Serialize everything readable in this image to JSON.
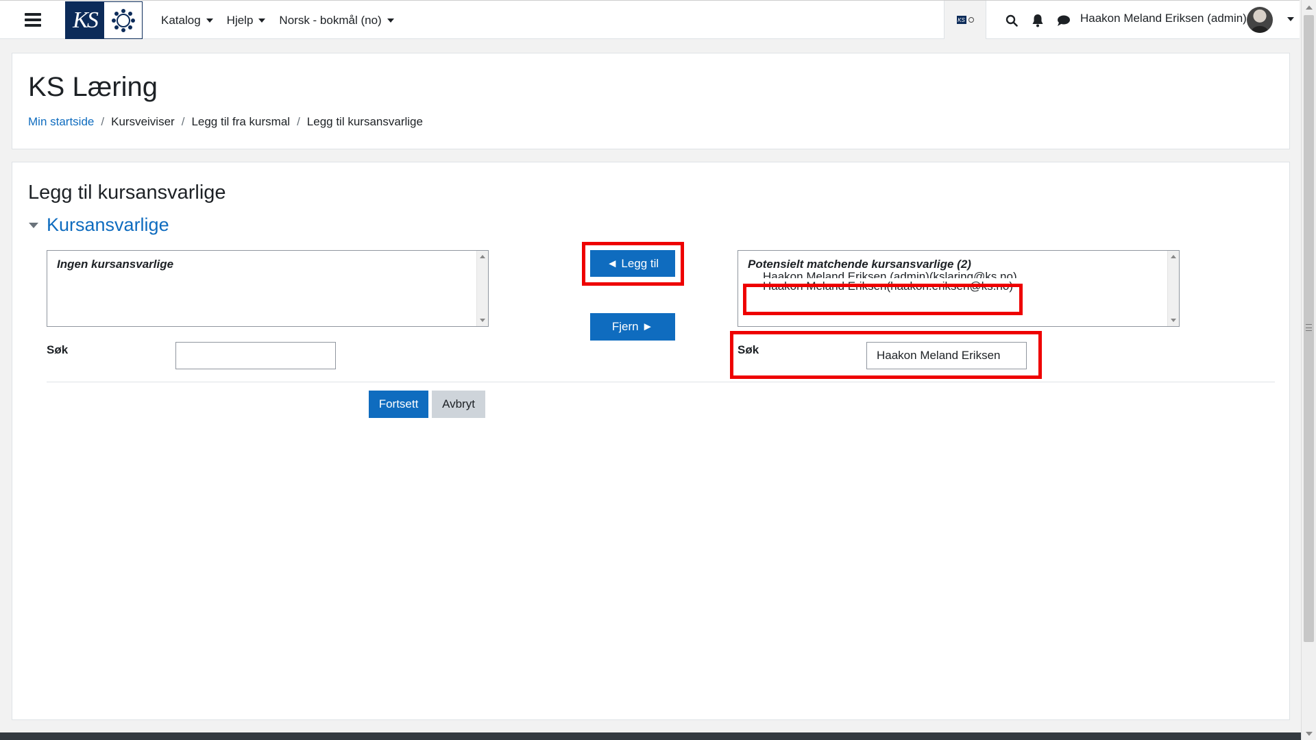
{
  "navbar": {
    "logo_text": "KS",
    "menu": [
      {
        "label": "Katalog"
      },
      {
        "label": "Hjelp"
      },
      {
        "label": "Norsk - bokmål (no)"
      }
    ],
    "mini_logo_text": "KS",
    "user_name": "Haakon Meland Eriksen (admin)"
  },
  "header": {
    "site_title": "KS Læring",
    "breadcrumb": [
      {
        "label": "Min startside"
      },
      {
        "label": "Kursveiviser"
      },
      {
        "label": "Legg til fra kursmal"
      },
      {
        "label": "Legg til kursansvarlige"
      }
    ],
    "separator": "/"
  },
  "main": {
    "page_heading": "Legg til kursansvarlige",
    "section_title": "Kursansvarlige",
    "current_list": {
      "group_label": "Ingen kursansvarlige"
    },
    "potential_list": {
      "group_label": "Potensielt matchende kursansvarlige (2)",
      "options": [
        "Haakon Meland Eriksen (admin)(kslaring@ks.no)",
        "Haakon Meland Eriksen(haakon.eriksen@ks.no)"
      ]
    },
    "add_button": "◄ Legg til",
    "remove_button": "Fjern ►",
    "search_label": "Søk",
    "left_search_value": "",
    "right_search_value": "Haakon Meland Eriksen",
    "continue_button": "Fortsett",
    "cancel_button": "Avbryt"
  },
  "colors": {
    "primary": "#0f6cbf",
    "brand_navy": "#0c2b59",
    "highlight": "#ee0000"
  },
  "icons": [
    "hamburger-icon",
    "search-icon",
    "bell-icon",
    "chat-icon",
    "chevron-down-icon",
    "collapse-triangle-icon"
  ]
}
